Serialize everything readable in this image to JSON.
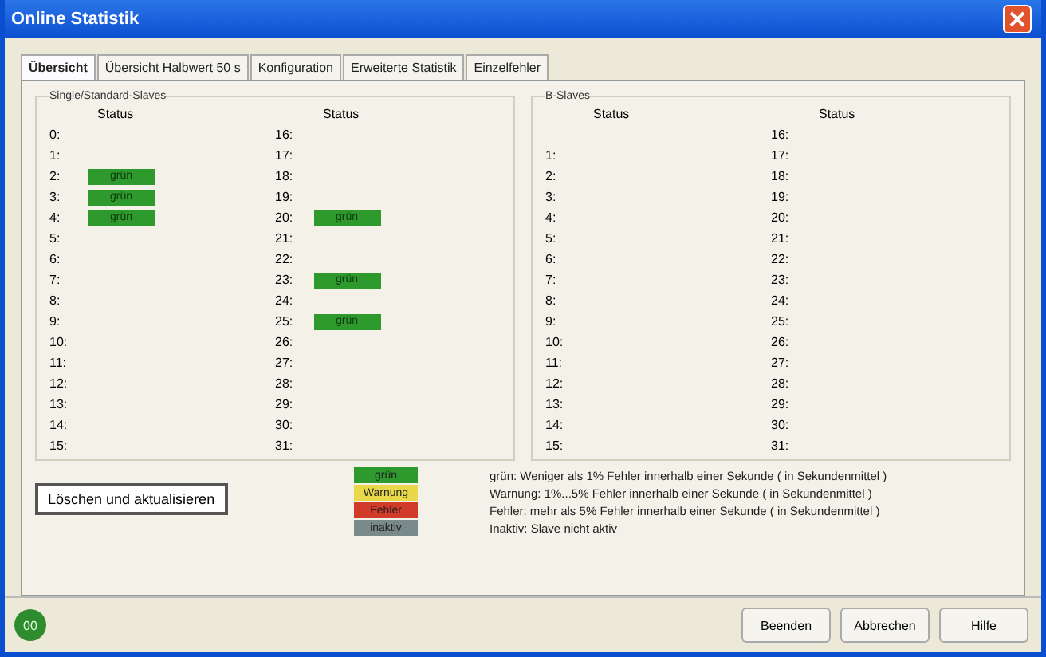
{
  "window": {
    "title": "Online Statistik"
  },
  "tabs": [
    {
      "label": "Übersicht",
      "selected": true
    },
    {
      "label": "Übersicht  Halbwert 50 s",
      "selected": false
    },
    {
      "label": "Konfiguration",
      "selected": false
    },
    {
      "label": "Erweiterte Statistik",
      "selected": false
    },
    {
      "label": "Einzelfehler",
      "selected": false
    }
  ],
  "groups": [
    {
      "title": "Single/Standard-Slaves",
      "columns": [
        {
          "header": "Status",
          "rows": [
            {
              "number": "0:"
            },
            {
              "number": "1:"
            },
            {
              "number": "2:",
              "status": "grün"
            },
            {
              "number": "3:",
              "status": "grün"
            },
            {
              "number": "4:",
              "status": "grün"
            },
            {
              "number": "5:"
            },
            {
              "number": "6:"
            },
            {
              "number": "7:"
            },
            {
              "number": "8:"
            },
            {
              "number": "9:"
            },
            {
              "number": "10:"
            },
            {
              "number": "11:"
            },
            {
              "number": "12:"
            },
            {
              "number": "13:"
            },
            {
              "number": "14:"
            },
            {
              "number": "15:"
            }
          ]
        },
        {
          "header": "Status",
          "rows": [
            {
              "number": "16:"
            },
            {
              "number": "17:"
            },
            {
              "number": "18:"
            },
            {
              "number": "19:"
            },
            {
              "number": "20:",
              "status": "grün"
            },
            {
              "number": "21:"
            },
            {
              "number": "22:"
            },
            {
              "number": "23:",
              "status": "grün"
            },
            {
              "number": "24:"
            },
            {
              "number": "25:",
              "status": "grün"
            },
            {
              "number": "26:"
            },
            {
              "number": "27:"
            },
            {
              "number": "28:"
            },
            {
              "number": "29:"
            },
            {
              "number": "30:"
            },
            {
              "number": "31:"
            }
          ]
        }
      ]
    },
    {
      "title": "B-Slaves",
      "columns": [
        {
          "header": "Status",
          "rows": [
            {},
            {
              "number": "1:"
            },
            {
              "number": "2:"
            },
            {
              "number": "3:"
            },
            {
              "number": "4:"
            },
            {
              "number": "5:"
            },
            {
              "number": "6:"
            },
            {
              "number": "7:"
            },
            {
              "number": "8:"
            },
            {
              "number": "9:"
            },
            {
              "number": "10:"
            },
            {
              "number": "11:"
            },
            {
              "number": "12:"
            },
            {
              "number": "13:"
            },
            {
              "number": "14:"
            },
            {
              "number": "15:"
            }
          ]
        },
        {
          "header": "Status",
          "rows": [
            {
              "number": "16:"
            },
            {
              "number": "17:"
            },
            {
              "number": "18:"
            },
            {
              "number": "19:"
            },
            {
              "number": "20:"
            },
            {
              "number": "21:"
            },
            {
              "number": "22:"
            },
            {
              "number": "23:"
            },
            {
              "number": "24:"
            },
            {
              "number": "25:"
            },
            {
              "number": "26:"
            },
            {
              "number": "27:"
            },
            {
              "number": "28:"
            },
            {
              "number": "29:"
            },
            {
              "number": "30:"
            },
            {
              "number": "31:"
            }
          ]
        }
      ]
    }
  ],
  "refresh_button": "Löschen und aktualisieren",
  "legend": [
    {
      "label": "grün",
      "color": "#2e9a2e",
      "text": "grün: Weniger als 1% Fehler innerhalb einer Sekunde ( in Sekundenmittel )"
    },
    {
      "label": "Warnung",
      "color": "#e8d84a",
      "text": "Warnung: 1%...5% Fehler innerhalb einer Sekunde ( in Sekundenmittel )"
    },
    {
      "label": "Fehler",
      "color": "#d23a2a",
      "text": "Fehler: mehr als 5% Fehler innerhalb einer Sekunde ( in Sekundenmittel )"
    },
    {
      "label": "inaktiv",
      "color": "#7a8a8a",
      "text": "Inaktiv: Slave nicht aktiv"
    }
  ],
  "status_indicator": "00",
  "buttons": [
    "Beenden",
    "Abbrechen",
    "Hilfe"
  ]
}
